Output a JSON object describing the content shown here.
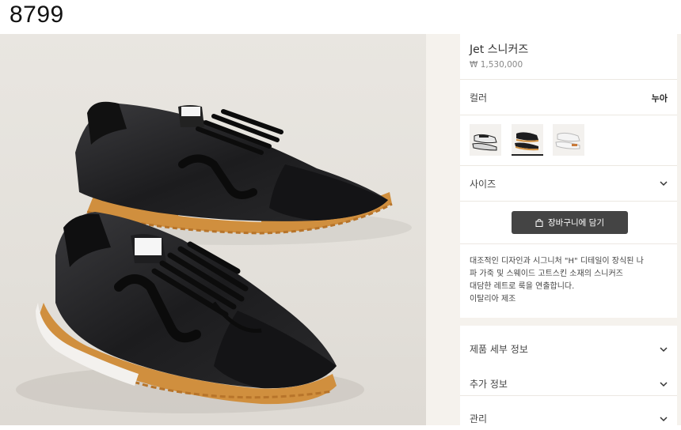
{
  "page": {
    "id_label": "8799"
  },
  "product": {
    "name": "Jet 스니커즈",
    "price": "₩ 1,530,000",
    "image_alt": "Jet 스니커즈 - 블랙 가죽 및 스웨이드, 오렌지 러버 솔"
  },
  "color": {
    "label": "컬러",
    "selected_value": "누아",
    "swatches": [
      {
        "name": "white-black",
        "selected": false
      },
      {
        "name": "black",
        "selected": true
      },
      {
        "name": "white",
        "selected": false
      }
    ]
  },
  "size": {
    "label": "사이즈"
  },
  "cart": {
    "button_label": "장바구니에 담기"
  },
  "description": {
    "lines": [
      "대조적인 디자인과 시그니처 \"H\" 디테일이 장식된 나",
      "파 가죽 및 스웨이드 고트스킨 소재의 스니커즈",
      "대담한 레트로 룩을 연출합니다.",
      "이탈리아 제조"
    ]
  },
  "accordions": [
    {
      "label": "제품 세부 정보"
    },
    {
      "label": "추가 정보"
    },
    {
      "label": "관리"
    }
  ],
  "colors": {
    "panel_bg": "#f5f2ed",
    "button_bg": "#444444",
    "sole": "#d08f3e",
    "leather": "#1d1d1f"
  }
}
